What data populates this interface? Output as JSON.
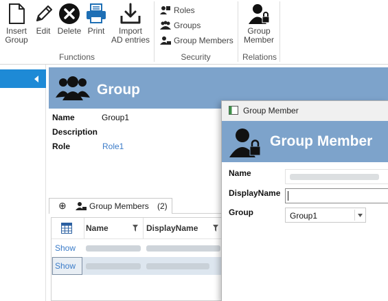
{
  "ribbon": {
    "functions": {
      "label": "Functions",
      "buttons": [
        {
          "name": "insert-group",
          "label_line1": "Insert",
          "label_line2": "Group"
        },
        {
          "name": "edit",
          "label": "Edit"
        },
        {
          "name": "delete",
          "label": "Delete"
        },
        {
          "name": "print",
          "label": "Print"
        },
        {
          "name": "import-ad",
          "label_line1": "Import",
          "label_line2": "AD entries"
        }
      ]
    },
    "security": {
      "label": "Security",
      "items": [
        "Roles",
        "Groups",
        "Group Members"
      ]
    },
    "relations": {
      "label": "Relations",
      "button_line1": "Group",
      "button_line2": "Member"
    }
  },
  "group_panel": {
    "title": "Group",
    "fields": {
      "name_label": "Name",
      "name_value": "Group1",
      "description_label": "Description",
      "role_label": "Role",
      "role_value": "Role1"
    },
    "tab": {
      "add_symbol": "⊕",
      "label": "Group Members",
      "count": "(2)"
    },
    "grid": {
      "columns": [
        "Name",
        "DisplayName"
      ],
      "rows": [
        {
          "action": "Show"
        },
        {
          "action": "Show"
        }
      ]
    }
  },
  "dialog": {
    "window_title": "Group Member",
    "header_title": "Group Member",
    "name_label": "Name",
    "displayname_label": "DisplayName",
    "group_label": "Group",
    "group_value": "Group1"
  },
  "colors": {
    "header_bg": "#7da3cb",
    "accent_blue": "#1e8ad6",
    "link": "#3a7bc8"
  }
}
